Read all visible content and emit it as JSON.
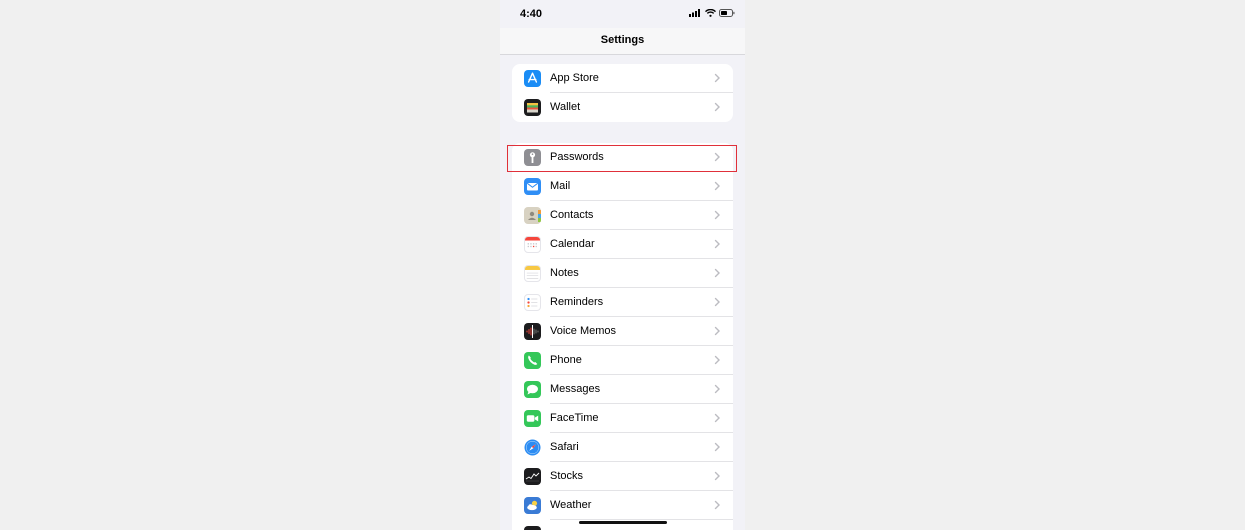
{
  "status_bar": {
    "time": "4:40"
  },
  "nav": {
    "title": "Settings"
  },
  "group1": [
    {
      "label": "App Store",
      "icon": "app-store-icon",
      "color": "#1a8cf5"
    },
    {
      "label": "Wallet",
      "icon": "wallet-icon",
      "color": "#1c1c1e"
    }
  ],
  "group2": [
    {
      "label": "Passwords",
      "icon": "key-icon",
      "color": "#8e8e93"
    },
    {
      "label": "Mail",
      "icon": "mail-icon",
      "color": "#2f8ef5"
    },
    {
      "label": "Contacts",
      "icon": "contacts-icon",
      "color": "#c9c3b3"
    },
    {
      "label": "Calendar",
      "icon": "calendar-icon",
      "color": "#ffffff"
    },
    {
      "label": "Notes",
      "icon": "notes-icon",
      "color": "#ffffff"
    },
    {
      "label": "Reminders",
      "icon": "reminders-icon",
      "color": "#ffffff"
    },
    {
      "label": "Voice Memos",
      "icon": "voice-memos-icon",
      "color": "#1c1c1e"
    },
    {
      "label": "Phone",
      "icon": "phone-icon",
      "color": "#34c759"
    },
    {
      "label": "Messages",
      "icon": "messages-icon",
      "color": "#34c759"
    },
    {
      "label": "FaceTime",
      "icon": "facetime-icon",
      "color": "#34c759"
    },
    {
      "label": "Safari",
      "icon": "safari-icon",
      "color": "#2c8cf2"
    },
    {
      "label": "Stocks",
      "icon": "stocks-icon",
      "color": "#1c1c1e"
    },
    {
      "label": "Weather",
      "icon": "weather-icon",
      "color": "#3a7bd5"
    },
    {
      "label": "",
      "icon": "partial-row-icon",
      "color": "#1c1c1e"
    }
  ],
  "colors": {
    "highlight": "#e0303a",
    "background": "#f2f2f7"
  }
}
